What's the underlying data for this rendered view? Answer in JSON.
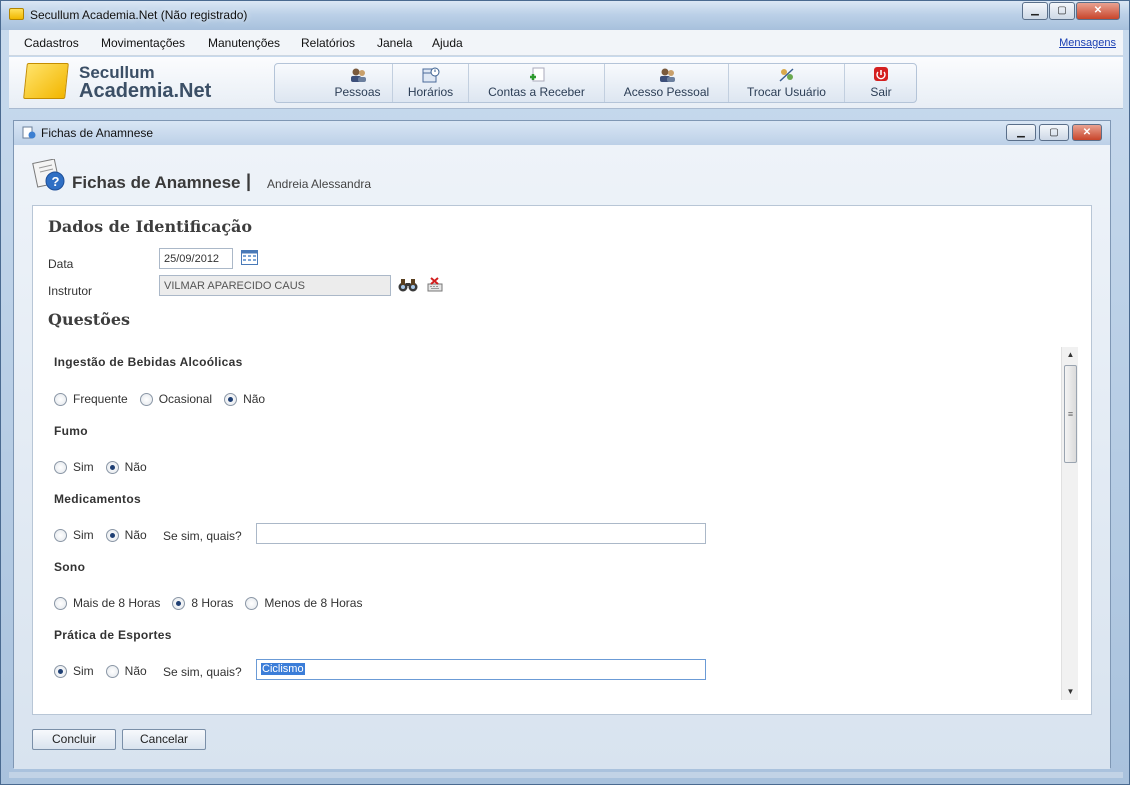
{
  "window": {
    "title": "Secullum Academia.Net (Não registrado)",
    "controls": {
      "minimize": "▁",
      "maximize": "▢",
      "close": "✕"
    }
  },
  "menubar": {
    "items": [
      "Cadastros",
      "Movimentações",
      "Manutenções",
      "Relatórios",
      "Janela",
      "Ajuda"
    ],
    "link": "Mensagens"
  },
  "logo": {
    "line1": "Secullum",
    "line2": "Academia.Net"
  },
  "toolbar": {
    "buttons": [
      {
        "label": "Pessoas",
        "icon": "people-icon"
      },
      {
        "label": "Horários",
        "icon": "schedule-icon"
      },
      {
        "label": "Contas a Receber",
        "icon": "receivables-icon"
      },
      {
        "label": "Acesso Pessoal",
        "icon": "access-icon"
      },
      {
        "label": "Trocar Usuário",
        "icon": "switch-user-icon"
      },
      {
        "label": "Sair",
        "icon": "power-icon"
      }
    ]
  },
  "child": {
    "title": "Fichas de Anamnese",
    "header": {
      "title": "Fichas de Anamnese",
      "separator": "|",
      "subtitle": "Andreia Alessandra"
    }
  },
  "form": {
    "identification_title": "Dados de Identificação",
    "date_label": "Data",
    "date_value": "25/09/2012",
    "instructor_label": "Instrutor",
    "instructor_value": "VILMAR APARECIDO CAUS",
    "questions_title": "Questões",
    "questions": [
      {
        "title": "Ingestão de Bebidas Alcoólicas",
        "options": [
          "Frequente",
          "Ocasional",
          "Não"
        ],
        "selected": 2
      },
      {
        "title": "Fumo",
        "options": [
          "Sim",
          "Não"
        ],
        "selected": 1
      },
      {
        "title": "Medicamentos",
        "options": [
          "Sim",
          "Não"
        ],
        "selected": 1,
        "follow_label": "Se sim, quais?",
        "follow_value": ""
      },
      {
        "title": "Sono",
        "options": [
          "Mais de 8 Horas",
          "8 Horas",
          "Menos de 8 Horas"
        ],
        "selected": 1
      },
      {
        "title": "Prática de Esportes",
        "options": [
          "Sim",
          "Não"
        ],
        "selected": 0,
        "follow_label": "Se sim, quais?",
        "follow_value": "Ciclismo"
      }
    ]
  },
  "actions": {
    "confirm": "Concluir",
    "cancel": "Cancelar"
  }
}
